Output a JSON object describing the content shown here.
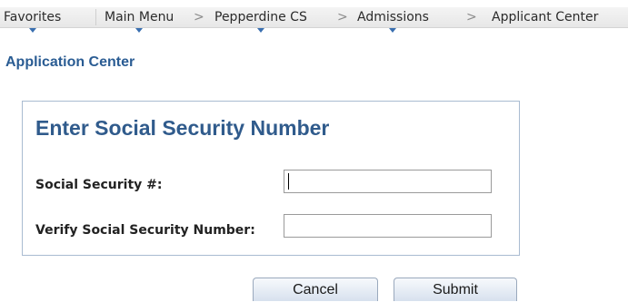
{
  "nav": {
    "favorites": "Favorites",
    "main_menu": "Main Menu",
    "pepperdine_cs": "Pepperdine CS",
    "admissions": "Admissions",
    "applicant_center": "Applicant Center",
    "separator": ">"
  },
  "page": {
    "title": "Application Center"
  },
  "panel": {
    "title": "Enter Social Security Number",
    "ssn_label": "Social Security #:",
    "ssn_value": "",
    "verify_label": "Verify Social Security Number:",
    "verify_value": ""
  },
  "actions": {
    "cancel_label": "Cancel",
    "submit_label": "Submit"
  },
  "colors": {
    "title_blue": "#2a5c93",
    "panel_border": "#a9bbd1",
    "menu_arrow": "#3a6fb0"
  }
}
